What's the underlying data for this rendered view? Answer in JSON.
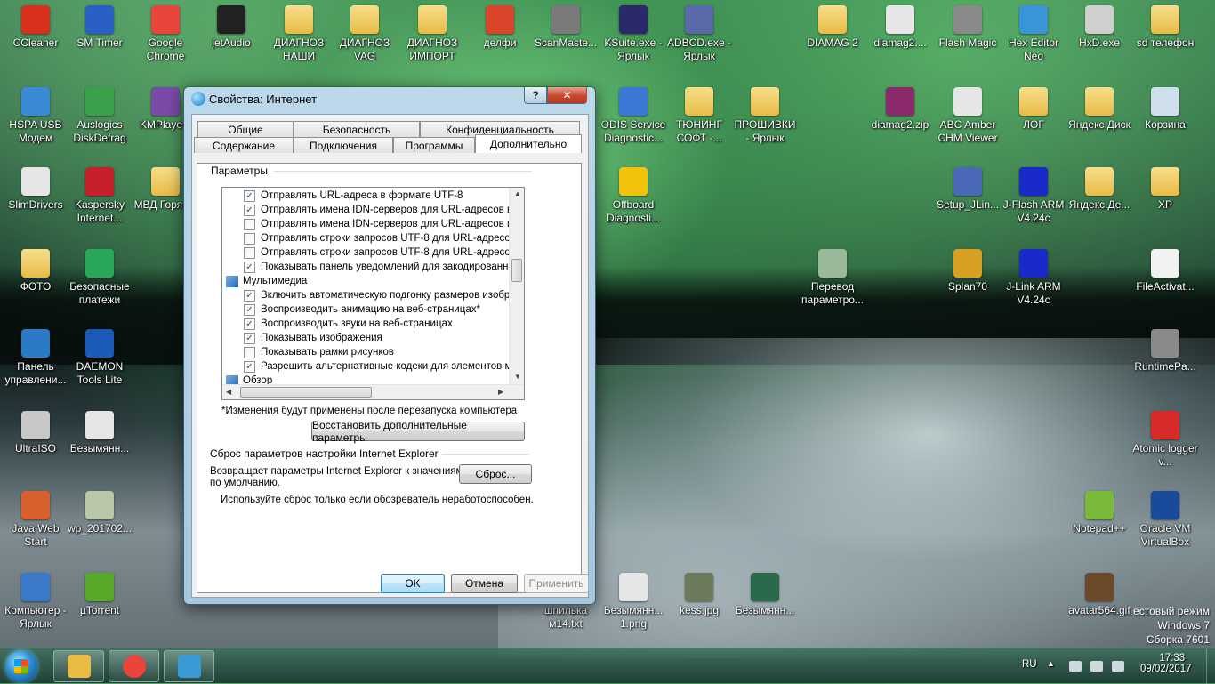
{
  "desktop": {
    "icons": [
      {
        "label": "CCleaner",
        "icon": "ccleaner-icon",
        "color": "#d9301e"
      },
      {
        "label": "SM Timer",
        "icon": "timer-icon",
        "color": "#2a5fc4"
      },
      {
        "label": "Google Chrome",
        "icon": "chrome-icon",
        "color": "#e8453c"
      },
      {
        "label": "jetAudio",
        "icon": "jetaudio-icon",
        "color": "#222222"
      },
      {
        "label": "ДИАГНОЗ НАШИ",
        "icon": "folder-icon",
        "color": "#e8bb45"
      },
      {
        "label": "ДИАГНОЗ VAG",
        "icon": "folder-icon",
        "color": "#e8bb45"
      },
      {
        "label": "ДИАГНОЗ ИМПОРТ",
        "icon": "folder-icon",
        "color": "#e8bb45"
      },
      {
        "label": "делфи",
        "icon": "delphi-icon",
        "color": "#d9452b"
      },
      {
        "label": "ScanMaste...",
        "icon": "scanmaster-icon",
        "color": "#7a7a7a"
      },
      {
        "label": "KSuite.exe - Ярлык",
        "icon": "ksuite-icon",
        "color": "#2a2a6a"
      },
      {
        "label": "ADBCD.exe - Ярлык",
        "icon": "adbcd-icon",
        "color": "#5a6aa8"
      },
      {
        "label": "DIAMAG 2",
        "icon": "folder-icon",
        "color": "#e8bb45"
      },
      {
        "label": "diamag2....",
        "icon": "archive-icon",
        "color": "#e6e6e6"
      },
      {
        "label": "Flash Magic",
        "icon": "flash-magic-icon",
        "color": "#8a8a8a"
      },
      {
        "label": "Hex Editor Neo",
        "icon": "hex-editor-icon",
        "color": "#3a95d6"
      },
      {
        "label": "HxD.exe",
        "icon": "hxd-icon",
        "color": "#cfcfcf"
      },
      {
        "label": "sd телефон",
        "icon": "folder-icon",
        "color": "#e8bb45"
      },
      {
        "label": "HSPA USB Модем",
        "icon": "modem-icon",
        "color": "#3a8ad6"
      },
      {
        "label": "Auslogics DiskDefrag",
        "icon": "defrag-icon",
        "color": "#3aa04a"
      },
      {
        "label": "KMPlaye...",
        "icon": "kmplayer-icon",
        "color": "#7a4aa8"
      },
      {
        "label": "ODIS Service Diagnostic...",
        "icon": "odis-icon",
        "color": "#3a7ad6"
      },
      {
        "label": "ТЮНИНГ СОФТ -...",
        "icon": "folder-icon",
        "color": "#e8bb45"
      },
      {
        "label": "ПРОШИВКИ - Ярлык",
        "icon": "folder-icon",
        "color": "#e8bb45"
      },
      {
        "label": "diamag2.zip",
        "icon": "winrar-icon",
        "color": "#8a2a6a"
      },
      {
        "label": "ABC Amber CHM Viewer",
        "icon": "chm-icon",
        "color": "#e6e6e6"
      },
      {
        "label": "ЛОГ",
        "icon": "folder-icon",
        "color": "#e8bb45"
      },
      {
        "label": "Яндекс.Диск",
        "icon": "folder-icon",
        "color": "#e8bb45"
      },
      {
        "label": "Корзина",
        "icon": "recycle-bin-icon",
        "color": "#cfe0ec"
      },
      {
        "label": "SlimDrivers",
        "icon": "slimdrivers-icon",
        "color": "#e6e6e6"
      },
      {
        "label": "Kaspersky Internet...",
        "icon": "kaspersky-icon",
        "color": "#c8202a"
      },
      {
        "label": "МВД Горяч...",
        "icon": "folder-icon",
        "color": "#e8bb45"
      },
      {
        "label": "Offboard Diagnosti...",
        "icon": "offboard-icon",
        "color": "#f2c20a"
      },
      {
        "label": "Setup_JLin...",
        "icon": "setup-icon",
        "color": "#4a6ab8"
      },
      {
        "label": "J-Flash ARM V4.24c",
        "icon": "jflash-icon",
        "color": "#1a2ac8"
      },
      {
        "label": "Яндекс.Де...",
        "icon": "folder-icon",
        "color": "#e8bb45"
      },
      {
        "label": "XP",
        "icon": "folder-icon",
        "color": "#e8bb45"
      },
      {
        "label": "ФОТО",
        "icon": "folder-icon",
        "color": "#e8bb45"
      },
      {
        "label": "Безопасные платежи",
        "icon": "safe-money-icon",
        "color": "#2aa85a"
      },
      {
        "label": "Перевод параметро...",
        "icon": "document-icon",
        "color": "#9ab89a"
      },
      {
        "label": "Splan70",
        "icon": "splan-icon",
        "color": "#d8a020"
      },
      {
        "label": "J-Link ARM V4.24c",
        "icon": "jlink-icon",
        "color": "#1a2ac8"
      },
      {
        "label": "FileActivat...",
        "icon": "file-icon",
        "color": "#f2f2f2"
      },
      {
        "label": "Панель управлени...",
        "icon": "control-panel-icon",
        "color": "#2a7ac8"
      },
      {
        "label": "DAEMON Tools Lite",
        "icon": "daemon-tools-icon",
        "color": "#1a5ab8"
      },
      {
        "label": "RuntimePa...",
        "icon": "runtime-icon",
        "color": "#8a8a8a"
      },
      {
        "label": "UltraISO",
        "icon": "ultraiso-icon",
        "color": "#c8c8c8"
      },
      {
        "label": "Безымянн...",
        "icon": "image-icon",
        "color": "#e6e6e6"
      },
      {
        "label": "Atomic logger v...",
        "icon": "atomic-icon",
        "color": "#d82a2a"
      },
      {
        "label": "Java Web Start",
        "icon": "java-icon",
        "color": "#d8602a"
      },
      {
        "label": "wp_201702...",
        "icon": "image-icon",
        "color": "#b8c8a8"
      },
      {
        "label": "Notepad++",
        "icon": "notepadpp-icon",
        "color": "#7ab83a"
      },
      {
        "label": "Oracle VM VirtualBox",
        "icon": "virtualbox-icon",
        "color": "#1a4a9a"
      },
      {
        "label": "Компьютер - Ярлык",
        "icon": "computer-icon",
        "color": "#3a7ac8"
      },
      {
        "label": "µTorrent",
        "icon": "utorrent-icon",
        "color": "#5aa82a"
      },
      {
        "label": "шпилька м14.txt",
        "icon": "text-file-icon",
        "color": "#f2f2f2"
      },
      {
        "label": "Безымянн... 1.png",
        "icon": "image-icon",
        "color": "#e6e6e6"
      },
      {
        "label": "kess.jpg",
        "icon": "image-icon",
        "color": "#6a7a5a"
      },
      {
        "label": "Безымянн...",
        "icon": "image-icon",
        "color": "#2a6a4a"
      },
      {
        "label": "avatar564.gif",
        "icon": "image-icon",
        "color": "#6a4a2a"
      }
    ]
  },
  "dialog": {
    "title": "Свойства: Интернет",
    "help_label": "?",
    "close_label": "✕",
    "tabs_row1": [
      "Общие",
      "Безопасность",
      "Конфиденциальность"
    ],
    "tabs_row2": [
      "Содержание",
      "Подключения",
      "Программы",
      "Дополнительно"
    ],
    "group_params": "Параметры",
    "settings": [
      {
        "text": "Отправлять URL-адреса в формате UTF-8",
        "type": "check",
        "checked": true
      },
      {
        "text": "Отправлять имена IDN-серверов для URL-адресов вне",
        "type": "check",
        "checked": true
      },
      {
        "text": "Отправлять имена IDN-серверов для URL-адресов инт",
        "type": "check",
        "checked": false
      },
      {
        "text": "Отправлять строки запросов UTF-8 для URL-адресов в",
        "type": "check",
        "checked": false
      },
      {
        "text": "Отправлять строки запросов UTF-8 для URL-адресов и",
        "type": "check",
        "checked": false
      },
      {
        "text": "Показывать панель уведомлений для закодированны:",
        "type": "check",
        "checked": true
      },
      {
        "text": "Мультимедиа",
        "type": "category"
      },
      {
        "text": "Включить автоматическую подгонку размеров изобра",
        "type": "check",
        "checked": true
      },
      {
        "text": "Воспроизводить анимацию на веб-страницах*",
        "type": "check",
        "checked": true
      },
      {
        "text": "Воспроизводить звуки на веб-страницах",
        "type": "check",
        "checked": true
      },
      {
        "text": "Показывать изображения",
        "type": "check",
        "checked": true
      },
      {
        "text": "Показывать рамки рисунков",
        "type": "check",
        "checked": false
      },
      {
        "text": "Разрешить альтернативные кодеки для элементов му",
        "type": "check",
        "checked": true
      },
      {
        "text": "Обзор",
        "type": "category"
      }
    ],
    "restart_note": "*Изменения будут применены после перезапуска компьютера",
    "restore_button": "Восстановить дополнительные параметры",
    "group_reset": "Сброс параметров настройки Internet Explorer",
    "reset_desc_line1": "Возвращает параметры Internet Explorer к значениям",
    "reset_desc_line2": "по умолчанию.",
    "reset_button": "Сброс...",
    "reset_warning": "Используйте сброс только если обозреватель неработоспособен.",
    "ok_button": "OK",
    "cancel_button": "Отмена",
    "apply_button": "Применить"
  },
  "taskbar": {
    "items": [
      {
        "name": "explorer-taskbar-button",
        "icon": "folder-icon",
        "color": "#e8bb45"
      },
      {
        "name": "chrome-taskbar-button",
        "icon": "chrome-icon",
        "color": "#e8453c"
      },
      {
        "name": "internet-options-taskbar-button",
        "icon": "internet-options-icon",
        "color": "#3a9ad6"
      }
    ],
    "language": "RU",
    "time": "17:33",
    "date": "09/02/2017"
  },
  "watermark": {
    "line1": "естовый режим",
    "line2": "Windows 7",
    "line3": "Сборка 7601"
  }
}
